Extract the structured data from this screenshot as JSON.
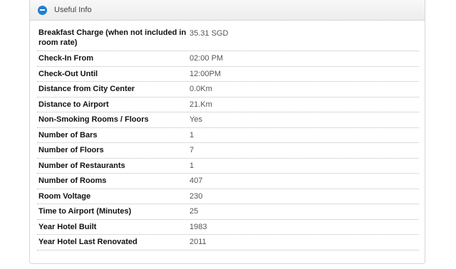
{
  "panel": {
    "title": "Useful Info",
    "collapse_icon": "minus-circle-icon",
    "accent_color": "#1f7fd3"
  },
  "rows": [
    {
      "label": "Breakfast Charge (when not included in room rate)",
      "value": "35.31 SGD"
    },
    {
      "label": "Check-In From",
      "value": "02:00 PM"
    },
    {
      "label": "Check-Out Until",
      "value": "12:00PM"
    },
    {
      "label": "Distance from City Center",
      "value": "0.0Km"
    },
    {
      "label": "Distance to Airport",
      "value": "21.Km"
    },
    {
      "label": "Non-Smoking Rooms / Floors",
      "value": "Yes"
    },
    {
      "label": "Number of Bars",
      "value": "1"
    },
    {
      "label": "Number of Floors",
      "value": "7"
    },
    {
      "label": "Number of Restaurants",
      "value": "1"
    },
    {
      "label": "Number of Rooms",
      "value": "407"
    },
    {
      "label": "Room Voltage",
      "value": "230"
    },
    {
      "label": "Time to Airport (Minutes)",
      "value": "25"
    },
    {
      "label": "Year Hotel Built",
      "value": "1983"
    },
    {
      "label": "Year Hotel Last Renovated",
      "value": "2011"
    }
  ]
}
